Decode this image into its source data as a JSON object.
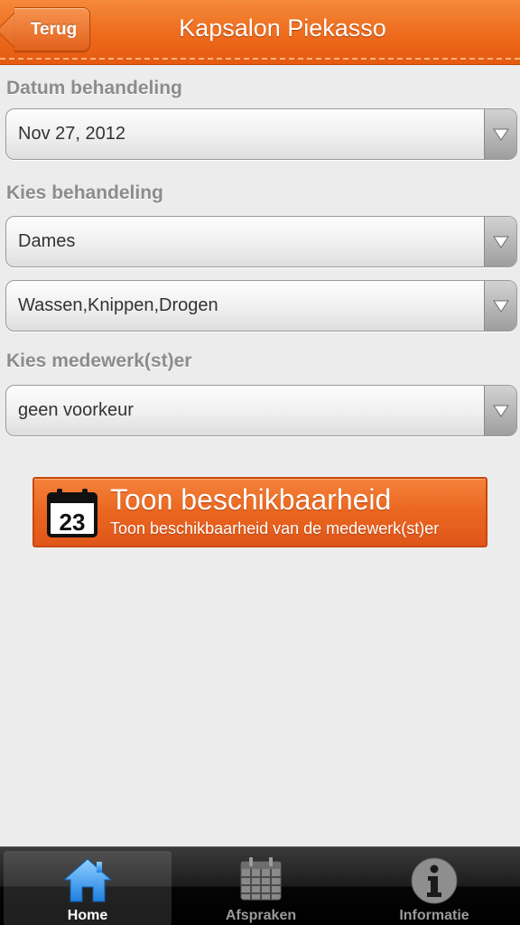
{
  "header": {
    "title": "Kapsalon Piekasso",
    "back_label": "Terug"
  },
  "form": {
    "date_label": "Datum behandeling",
    "date_value": "Nov 27, 2012",
    "treatment_label": "Kies behandeling",
    "category_value": "Dames",
    "treatment_value": "Wassen,Knippen,Drogen",
    "employee_label": "Kies medewerk(st)er",
    "employee_value": "geen voorkeur"
  },
  "action": {
    "title": "Toon beschikbaarheid",
    "subtitle": "Toon beschikbaarheid van de medewerk(st)er",
    "calendar_day": "23",
    "icon": "calendar-icon"
  },
  "tabbar": {
    "items": [
      {
        "label": "Home",
        "icon": "home-icon",
        "active": true
      },
      {
        "label": "Afspraken",
        "icon": "calendar-grid-icon",
        "active": false
      },
      {
        "label": "Informatie",
        "icon": "info-icon",
        "active": false
      }
    ]
  },
  "colors": {
    "accent": "#ee6a1c",
    "tab_active_icon": "#3b9cf0"
  }
}
